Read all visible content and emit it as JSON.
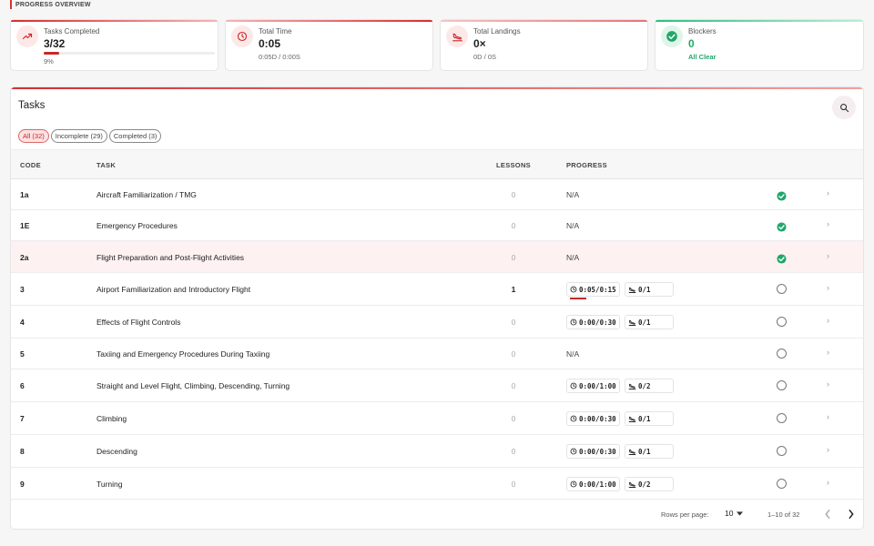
{
  "section": {
    "title": "PROGRESS OVERVIEW"
  },
  "stats": {
    "tasks_completed": {
      "label": "Tasks Completed",
      "value": "3/32",
      "percent_text": "9%",
      "progress": 0.09,
      "icon": "trending-up-icon",
      "color": "#c62828"
    },
    "total_time": {
      "label": "Total Time",
      "value": "0:05",
      "sub": "0:05D / 0:00S",
      "icon": "clock-icon",
      "color": "#c62828"
    },
    "total_landings": {
      "label": "Total Landings",
      "value": "0×",
      "sub": "0D / 0S",
      "icon": "landing-icon",
      "color": "#c62828"
    },
    "blockers": {
      "label": "Blockers",
      "value": "0",
      "sub": "All Clear",
      "icon": "check-circle-icon",
      "color": "#21a66b"
    }
  },
  "tasks_panel": {
    "title": "Tasks",
    "filters": [
      "All (32)",
      "Incomplete (29)",
      "Completed (3)"
    ],
    "columns": {
      "code": "CODE",
      "task": "TASK",
      "lessons": "LESSONS",
      "progress": "PROGRESS"
    },
    "rows": [
      {
        "code": "1a",
        "task": "Aircraft Familiarization / TMG",
        "lessons": "0",
        "progress_text": "N/A",
        "time": "",
        "landings": "",
        "complete": true
      },
      {
        "code": "1E",
        "task": "Emergency Procedures",
        "lessons": "0",
        "progress_text": "N/A",
        "time": "",
        "landings": "",
        "complete": true
      },
      {
        "code": "2a",
        "task": "Flight Preparation and Post-Flight Activities",
        "lessons": "0",
        "progress_text": "N/A",
        "time": "",
        "landings": "",
        "complete": true
      },
      {
        "code": "3",
        "task": "Airport Familiarization and Introductory Flight",
        "lessons": "1",
        "progress_text": "",
        "time": "0:05/0:15",
        "landings": "0/1",
        "complete": false
      },
      {
        "code": "4",
        "task": "Effects of Flight Controls",
        "lessons": "0",
        "progress_text": "",
        "time": "0:00/0:30",
        "landings": "0/1",
        "complete": false
      },
      {
        "code": "5",
        "task": "Taxiing and Emergency Procedures During Taxiing",
        "lessons": "0",
        "progress_text": "N/A",
        "time": "",
        "landings": "",
        "complete": false
      },
      {
        "code": "6",
        "task": "Straight and Level Flight, Climbing, Descending, Turning",
        "lessons": "0",
        "progress_text": "",
        "time": "0:00/1:00",
        "landings": "0/2",
        "complete": false
      },
      {
        "code": "7",
        "task": "Climbing",
        "lessons": "0",
        "progress_text": "",
        "time": "0:00/0:30",
        "landings": "0/1",
        "complete": false
      },
      {
        "code": "8",
        "task": "Descending",
        "lessons": "0",
        "progress_text": "",
        "time": "0:00/0:30",
        "landings": "0/1",
        "complete": false
      },
      {
        "code": "9",
        "task": "Turning",
        "lessons": "0",
        "progress_text": "",
        "time": "0:00/1:00",
        "landings": "0/2",
        "complete": false
      }
    ],
    "footer": {
      "rows_per_page_label": "Rows per page:",
      "rows_per_page": "10",
      "range": "1–10 of 32"
    }
  }
}
